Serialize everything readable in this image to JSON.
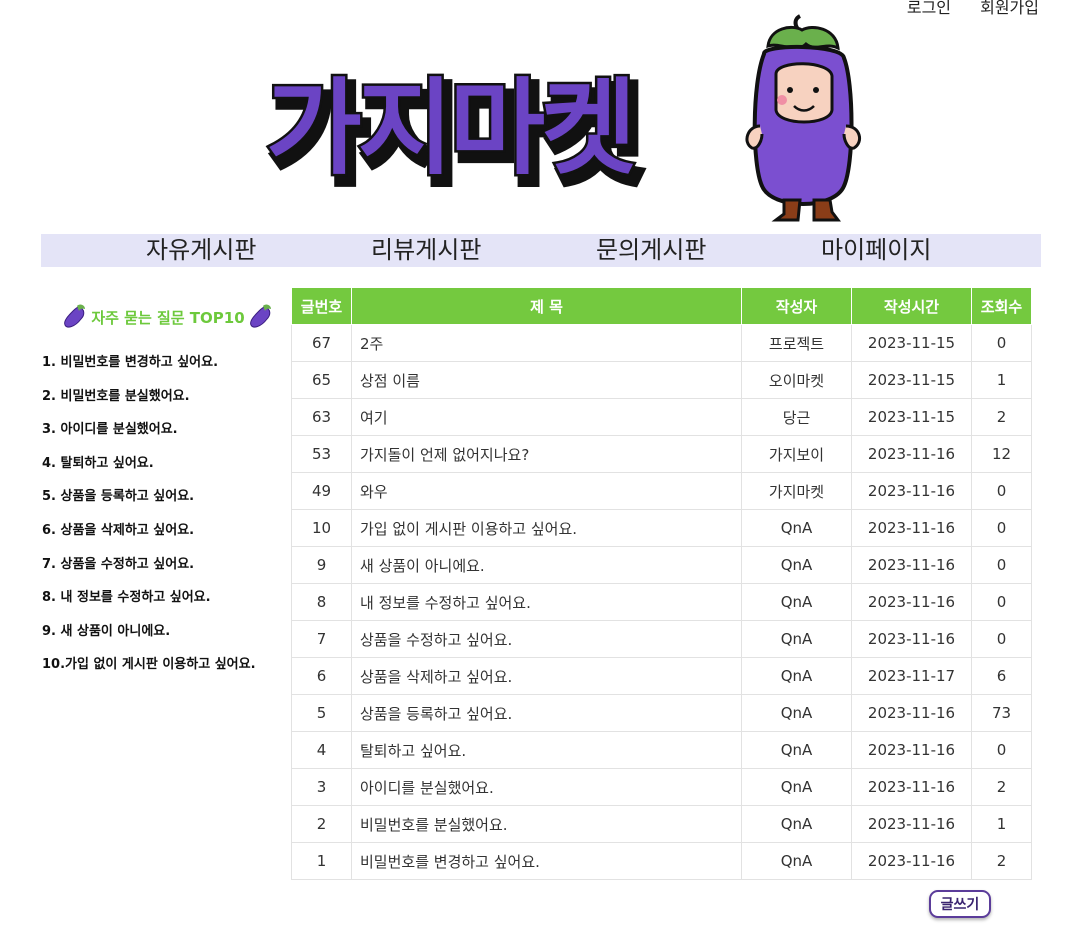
{
  "auth": {
    "login": "로그인",
    "signup": "회원가입"
  },
  "logo": {
    "text": "가지마켓"
  },
  "nav": [
    {
      "label": "자유게시판"
    },
    {
      "label": "리뷰게시판"
    },
    {
      "label": "문의게시판"
    },
    {
      "label": "마이페이지"
    }
  ],
  "faq": {
    "title": "자주 묻는 질문 TOP10",
    "items": [
      "1. 비밀번호를 변경하고 싶어요.",
      "2. 비밀번호를 분실했어요.",
      "3. 아이디를 분실했어요.",
      "4. 탈퇴하고 싶어요.",
      "5. 상품을 등록하고 싶어요.",
      "6. 상품을 삭제하고 싶어요.",
      "7. 상품을 수정하고 싶어요.",
      "8. 내 정보를 수정하고 싶어요.",
      "9. 새 상품이 아니에요.",
      "10.가입 없이 게시판 이용하고 싶어요."
    ]
  },
  "board": {
    "headers": [
      "글번호",
      "제 목",
      "작성자",
      "작성시간",
      "조회수"
    ],
    "rows": [
      [
        "67",
        "2주",
        "프로젝트",
        "2023-11-15",
        "0"
      ],
      [
        "65",
        "상점 이름",
        "오이마켓",
        "2023-11-15",
        "1"
      ],
      [
        "63",
        "여기",
        "당근",
        "2023-11-15",
        "2"
      ],
      [
        "53",
        "가지돌이 언제 없어지나요?",
        "가지보이",
        "2023-11-16",
        "12"
      ],
      [
        "49",
        "와우",
        "가지마켓",
        "2023-11-16",
        "0"
      ],
      [
        "10",
        "가입 없이 게시판 이용하고 싶어요.",
        "QnA",
        "2023-11-16",
        "0"
      ],
      [
        "9",
        "새 상품이 아니에요.",
        "QnA",
        "2023-11-16",
        "0"
      ],
      [
        "8",
        "내 정보를 수정하고 싶어요.",
        "QnA",
        "2023-11-16",
        "0"
      ],
      [
        "7",
        "상품을 수정하고 싶어요.",
        "QnA",
        "2023-11-16",
        "0"
      ],
      [
        "6",
        "상품을 삭제하고 싶어요.",
        "QnA",
        "2023-11-17",
        "6"
      ],
      [
        "5",
        "상품을 등록하고 싶어요.",
        "QnA",
        "2023-11-16",
        "73"
      ],
      [
        "4",
        "탈퇴하고 싶어요.",
        "QnA",
        "2023-11-16",
        "0"
      ],
      [
        "3",
        "아이디를 분실했어요.",
        "QnA",
        "2023-11-16",
        "2"
      ],
      [
        "2",
        "비밀번호를 분실했어요.",
        "QnA",
        "2023-11-16",
        "1"
      ],
      [
        "1",
        "비밀번호를 변경하고 싶어요.",
        "QnA",
        "2023-11-16",
        "2"
      ]
    ]
  },
  "write_button": "글쓰기",
  "colors": {
    "logo_purple": "#6b44c4",
    "header_green": "#74c93f",
    "nav_bg": "#e4e4f7"
  }
}
